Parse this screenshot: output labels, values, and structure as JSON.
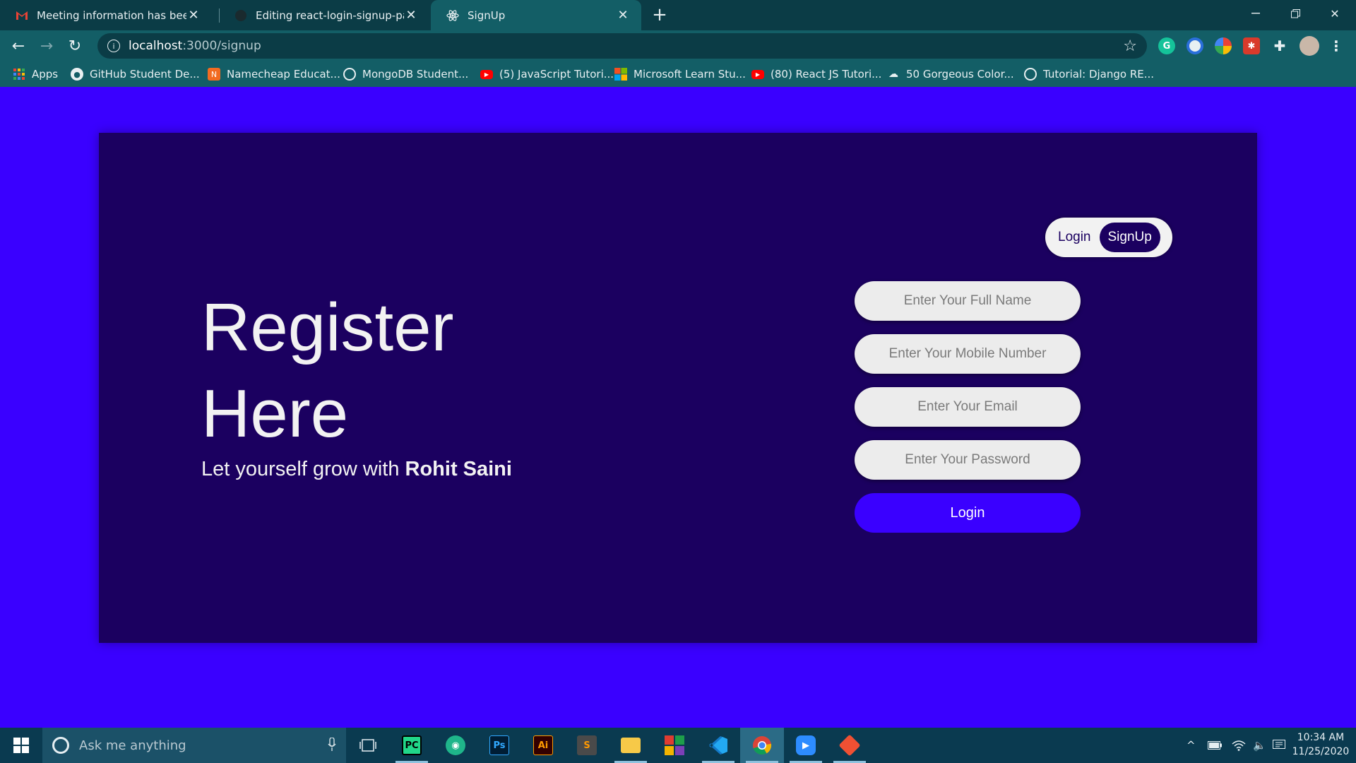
{
  "browser": {
    "tabs": [
      {
        "title": "Meeting information has been up",
        "favicon": "gmail-icon",
        "active": false
      },
      {
        "title": "Editing react-login-signup-page/",
        "favicon": "github-icon",
        "active": false
      },
      {
        "title": "SignUp",
        "favicon": "react-icon",
        "active": true
      }
    ],
    "new_tab": "+",
    "address": {
      "host": "localhost",
      "path": ":3000/signup"
    },
    "bookmarks": [
      {
        "label": "Apps",
        "icon": "apps-grid-icon"
      },
      {
        "label": "GitHub Student De...",
        "icon": "github-icon"
      },
      {
        "label": "Namecheap Educat...",
        "icon": "namecheap-icon"
      },
      {
        "label": "MongoDB Student...",
        "icon": "globe-icon"
      },
      {
        "label": "(5) JavaScript Tutori...",
        "icon": "youtube-icon"
      },
      {
        "label": "Microsoft Learn Stu...",
        "icon": "microsoft-icon"
      },
      {
        "label": "(80) React JS Tutori...",
        "icon": "youtube-icon"
      },
      {
        "label": "50 Gorgeous Color...",
        "icon": "palette-icon"
      },
      {
        "label": "Tutorial: Django RE...",
        "icon": "globe-icon"
      }
    ]
  },
  "page": {
    "title_line1": "Register",
    "title_line2": "Here",
    "subtitle_prefix": "Let yourself grow with ",
    "subtitle_name": "Rohit Saini",
    "toggle": {
      "login": "Login",
      "signup": "SignUp"
    },
    "fields": {
      "full_name": "Enter Your Full Name",
      "mobile": "Enter Your Mobile Number",
      "email": "Enter Your Email",
      "password": "Enter Your Password"
    },
    "submit": "Login"
  },
  "taskbar": {
    "search_placeholder": "Ask me anything",
    "apps": [
      "task-view-icon",
      "pycharm-icon",
      "maps-icon",
      "photoshop-icon",
      "illustrator-icon",
      "sublime-icon",
      "file-explorer-icon",
      "office-icon",
      "vscode-icon",
      "chrome-icon",
      "zoom-icon",
      "git-icon"
    ],
    "time": "10:34 AM",
    "date": "11/25/2020"
  },
  "colors": {
    "page_bg": "#3a00ff",
    "card_bg": "#1b0060",
    "chrome": "#135e66",
    "taskbar": "#0a3a50"
  }
}
